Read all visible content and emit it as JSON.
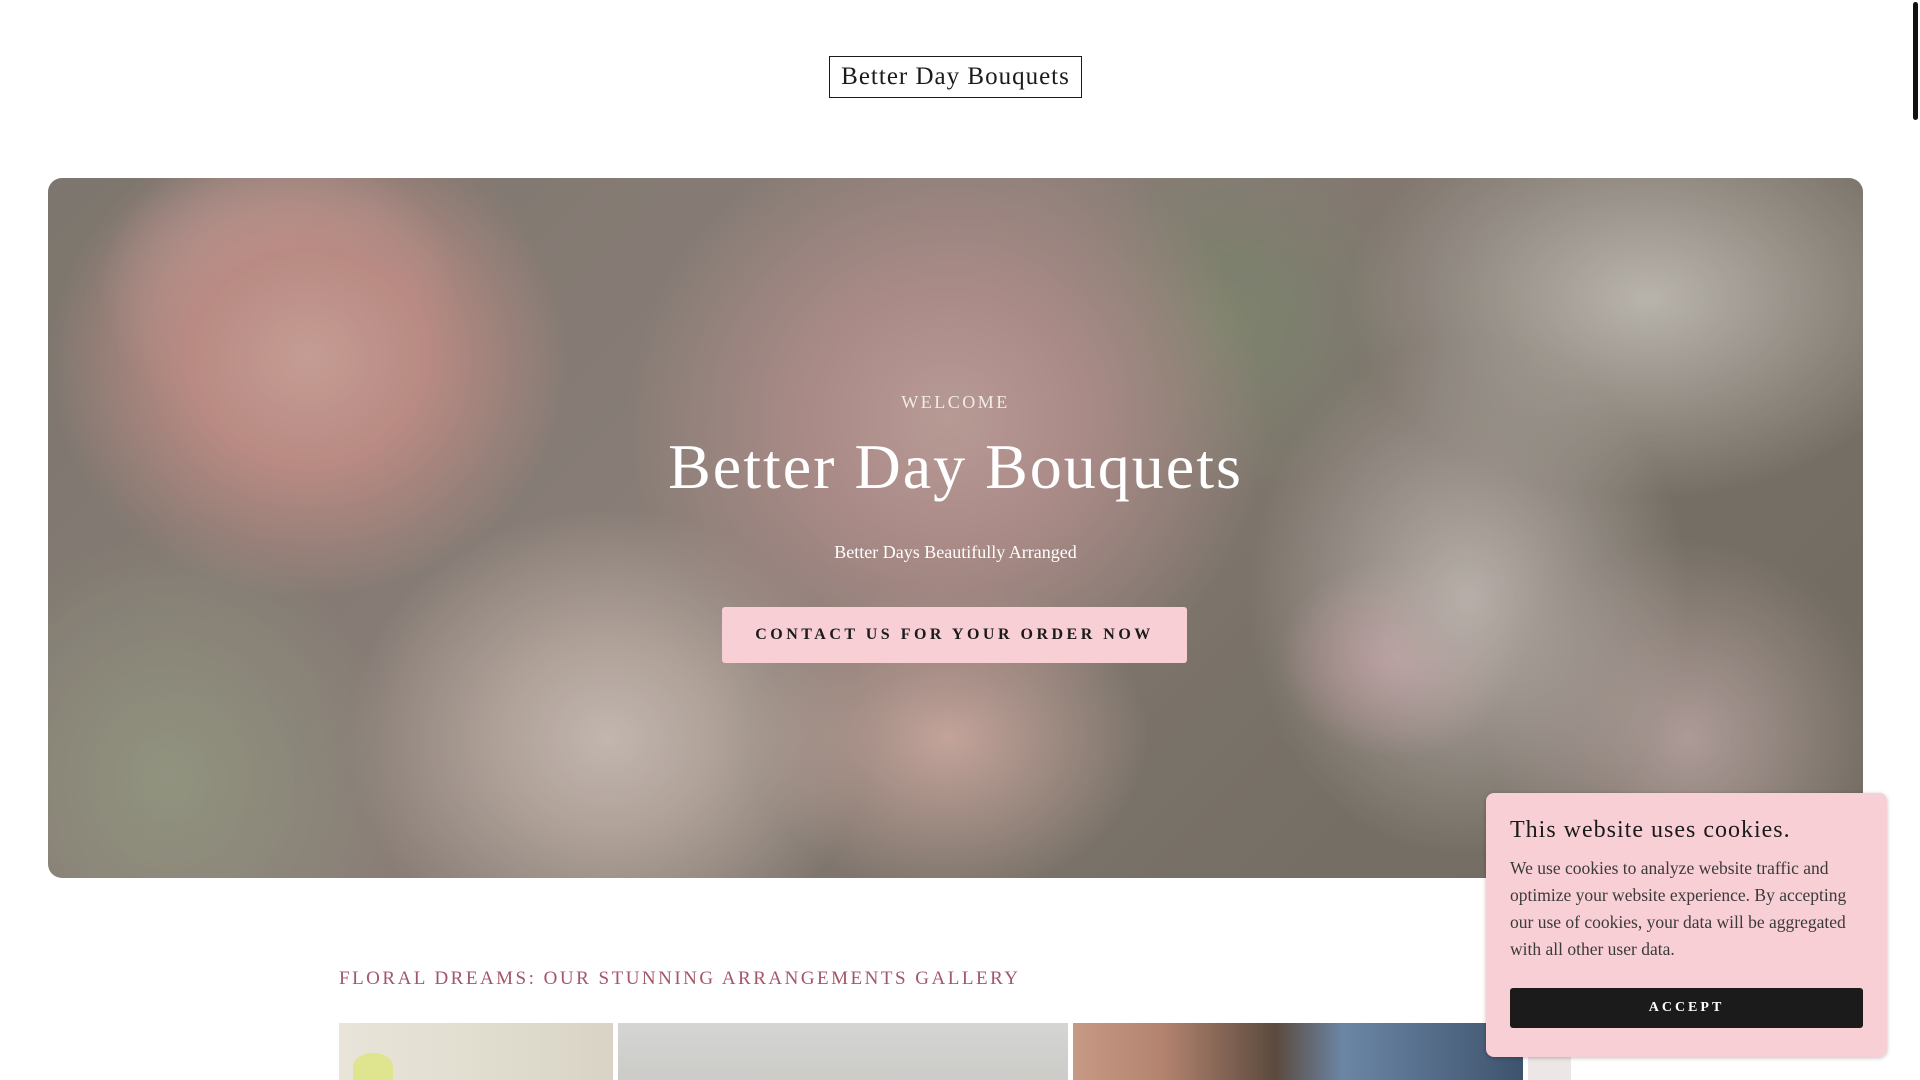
{
  "header": {
    "logo_text": "Better Day Bouquets"
  },
  "hero": {
    "eyebrow": "WELCOME",
    "title": "Better Day Bouquets",
    "subtitle": "Better Days Beautifully Arranged",
    "cta_label": "CONTACT US FOR YOUR ORDER NOW",
    "cta_color": "#f9cfd6"
  },
  "gallery": {
    "heading": "FLORAL DREAMS: OUR STUNNING ARRANGEMENTS GALLERY",
    "heading_color": "#a35668"
  },
  "cookie_banner": {
    "title": "This website uses cookies.",
    "text": "We use cookies to analyze website traffic and optimize your website experience. By accepting our use of cookies, your data will be aggregated with all other user data.",
    "accept_label": "ACCEPT",
    "background_color": "#f9cfd6"
  }
}
